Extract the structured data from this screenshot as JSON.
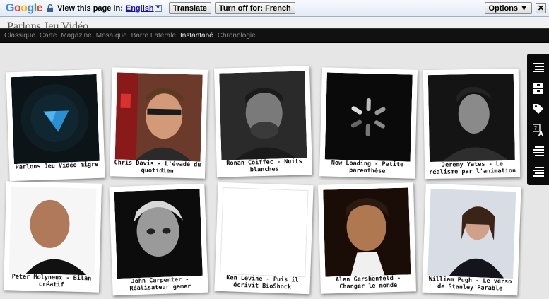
{
  "translate_bar": {
    "logo": "Google",
    "prompt": "View this page in:",
    "language_link": "English",
    "translate_button": "Translate",
    "turn_off_button": "Turn off for: French",
    "options_button": "Options ▼",
    "close_button": "✕"
  },
  "site": {
    "title": "Parlons Jeu Vidéo"
  },
  "nav": {
    "items": [
      {
        "label": "Classique"
      },
      {
        "label": "Carte"
      },
      {
        "label": "Magazine"
      },
      {
        "label": "Mosaïque"
      },
      {
        "label": "Barre Latérale"
      },
      {
        "label": "Instantané",
        "active": true
      },
      {
        "label": "Chronologie"
      }
    ]
  },
  "cards": [
    {
      "caption": "Parlons Jeu Vidéo migre"
    },
    {
      "caption": "Chris Davis - L'évadé du quotidien"
    },
    {
      "caption": "Ronan Coiffec - Nuits blanches"
    },
    {
      "caption": "Now Loading - Petite parenthèse"
    },
    {
      "caption": "Jeremy Yates - Le réalisme par l'animation"
    },
    {
      "caption": "Peter Molyneux - Bilan créatif"
    },
    {
      "caption": "John Carpenter - Réalisateur gamer"
    },
    {
      "caption": "Ken Levine - Puis il écrivit BioShock"
    },
    {
      "caption": "Alan Gershenfeld - Changer le monde"
    },
    {
      "caption": "William Pugh - Le verso de Stanley Parable"
    }
  ],
  "side_toolbar": {
    "icons": [
      "list-icon",
      "archive-icon",
      "tag-icon",
      "translate-icon",
      "list-alt-icon",
      "list-lines-icon"
    ]
  }
}
